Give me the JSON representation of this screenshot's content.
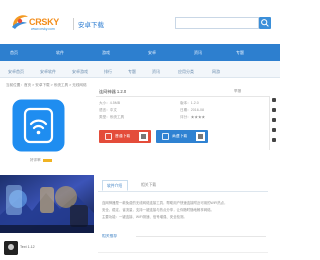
{
  "header": {
    "logo_text": "CRSKY",
    "logo_sub": "www.crsky.com",
    "channel_title": "安卓下载",
    "search_placeholder": ""
  },
  "nav": {
    "items": [
      "首页",
      "软件",
      "游戏",
      "安卓",
      "资讯",
      "专题"
    ]
  },
  "subnav": {
    "items": [
      "安卓首页",
      "安卓软件",
      "安卓游戏",
      "排行",
      "专题",
      "资讯",
      "应用分类",
      "网游"
    ]
  },
  "breadcrumb": "当前位置：首页 > 安卓下载 > 系统工具 > 无线网络",
  "app": {
    "name": "连网神器 1.2.0",
    "icon": "wifi-icon",
    "rating_label": "好评率",
    "top_right": "举报",
    "meta_left": [
      "大小：4.5MB",
      "语言：中文",
      "类型：系统工具"
    ],
    "meta_right": [
      "版本：1.2.0",
      "日期：2016-08",
      "评分：★★★★"
    ],
    "download_primary": "普通下载",
    "download_secondary": "高速下载",
    "colors": {
      "accent": "#2d7fcf",
      "download_red": "#e44c3a",
      "download_blue": "#2f82d2"
    }
  },
  "tabs": {
    "active": "软件介绍",
    "inactive": "相关下载"
  },
  "description": [
    "连网神器是一款免费的无线网络连接工具，帮助用户快速连接附近可用的WiFi热点，",
    "安全、稳定、省流量，支持一键连接与热点分享，让你随时随地畅享网络。",
    "主要功能：一键连接、WiFi测速、信号增强、安全检测。"
  ],
  "section_title": "相关推荐",
  "bottom_item": {
    "name": "Text 1.12"
  }
}
